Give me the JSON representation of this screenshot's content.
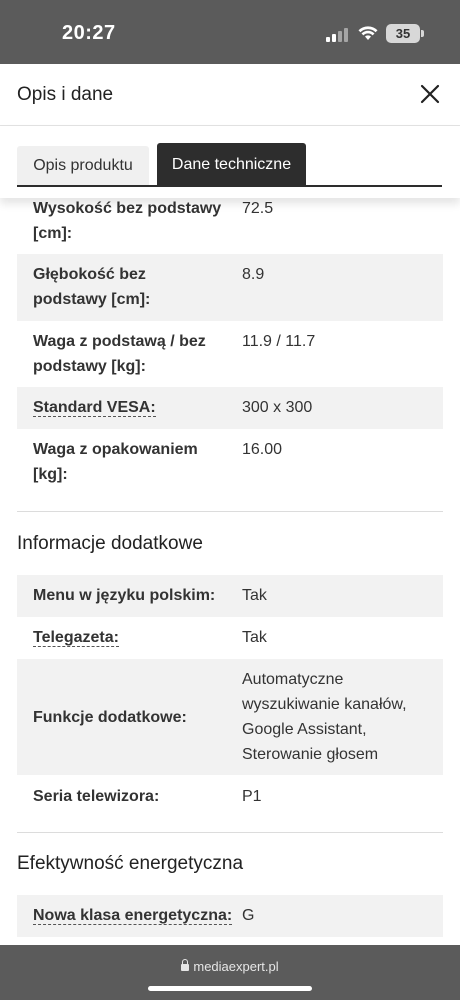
{
  "status_bar": {
    "time": "20:27",
    "battery": "35"
  },
  "header": {
    "title": "Opis i dane"
  },
  "tabs": [
    {
      "label": "Opis produktu",
      "active": false
    },
    {
      "label": "Dane techniczne",
      "active": true
    }
  ],
  "specs_top": [
    {
      "label": "Wysokość bez podstawy [cm]:",
      "value": "72.5"
    },
    {
      "label": "Głębokość bez podstawy [cm]:",
      "value": "8.9"
    },
    {
      "label": "Waga z podstawą / bez podstawy [kg]:",
      "value": "11.9 / 11.7"
    },
    {
      "label": "Standard VESA:",
      "value": "300 x 300"
    },
    {
      "label": "Waga z opakowaniem [kg]:",
      "value": "16.00"
    }
  ],
  "section_additional": {
    "title": "Informacje dodatkowe",
    "rows": [
      {
        "label": "Menu w języku polskim:",
        "value": "Tak"
      },
      {
        "label": "Telegazeta:",
        "value": "Tak"
      },
      {
        "label": "Funkcje dodatkowe:",
        "value": "Automatyczne wyszukiwanie kanałów, Google Assistant, Sterowanie głosem"
      },
      {
        "label": "Seria telewizora:",
        "value": "P1"
      }
    ]
  },
  "section_energy": {
    "title": "Efektywność energetyczna",
    "rows": [
      {
        "label": "Nowa klasa energetyczna:",
        "value": "G"
      }
    ]
  },
  "browser": {
    "url": "mediaexpert.pl"
  },
  "colors": {
    "status_bar_bg": "#5b5b5b",
    "active_tab_bg": "#2d2d2d",
    "row_shade": "#f2f2f2"
  }
}
